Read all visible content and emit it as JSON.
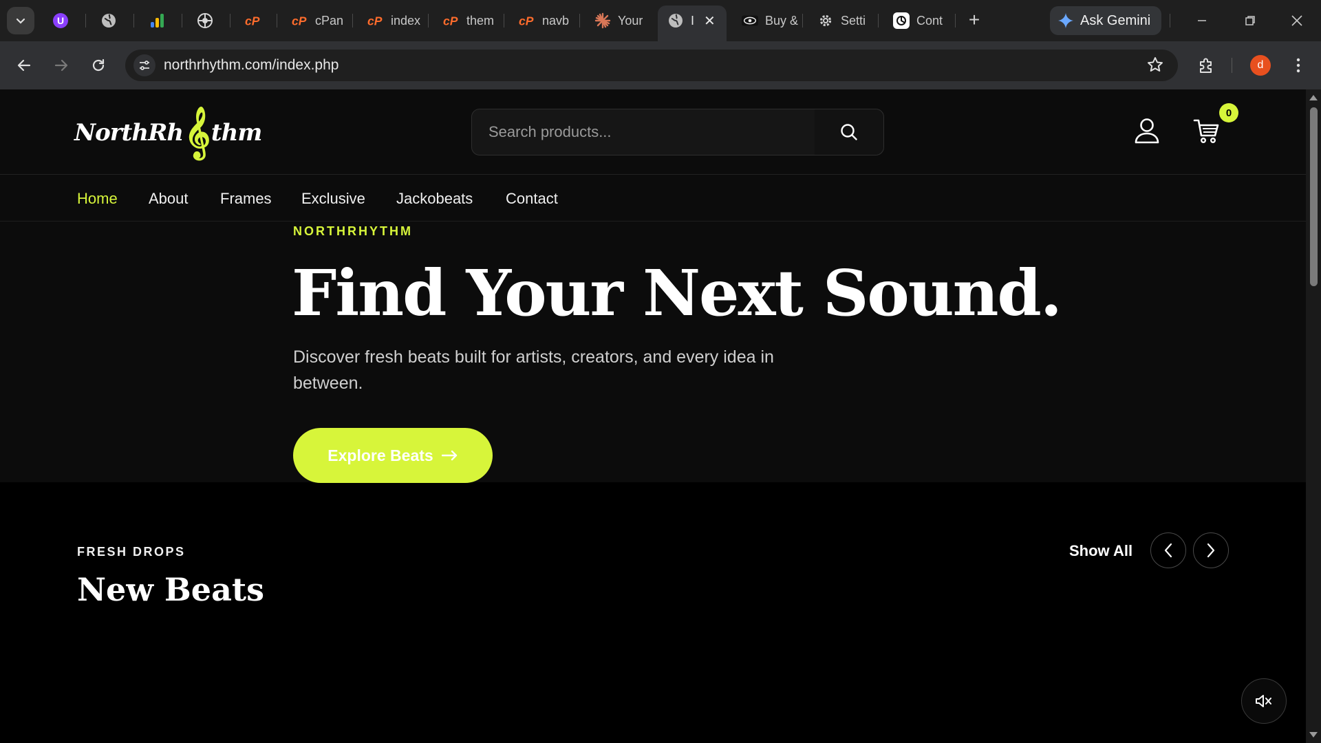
{
  "browser": {
    "tabs": [
      {
        "label": "",
        "icon": "u-extension-icon"
      },
      {
        "label": "",
        "icon": "globe-icon"
      },
      {
        "label": "",
        "icon": "analytics-icon"
      },
      {
        "label": "",
        "icon": "aperture-icon"
      },
      {
        "label": "",
        "icon": "cpanel-icon"
      },
      {
        "label": "cPan",
        "icon": "cpanel-icon"
      },
      {
        "label": "index",
        "icon": "cpanel-icon"
      },
      {
        "label": "them",
        "icon": "cpanel-icon"
      },
      {
        "label": "navb",
        "icon": "cpanel-icon"
      },
      {
        "label": "Your",
        "icon": "claude-icon"
      },
      {
        "label": "I",
        "icon": "globe-icon"
      },
      {
        "label": "Buy &",
        "icon": "eye-icon"
      },
      {
        "label": "Setti",
        "icon": "gear-icon"
      },
      {
        "label": "Cont",
        "icon": "openai-icon"
      }
    ],
    "active_tab_index": 10,
    "ask_gemini_label": "Ask Gemini",
    "url": "northrhythm.com/index.php",
    "profile_initial": "d",
    "accent_colors": {
      "profile": "#e8501f",
      "cpanel": "#ff6c2c"
    }
  },
  "site": {
    "logo": {
      "left": "NorthRh",
      "right": "thm",
      "clef": "𝄞"
    },
    "search_placeholder": "Search products...",
    "cart_count": "0",
    "nav": [
      "Home",
      "About",
      "Frames",
      "Exclusive",
      "Jackobeats",
      "Contact"
    ],
    "nav_active": "Home",
    "hero": {
      "eyebrow": "NORTHRHYTHM",
      "title": "Find Your Next Sound.",
      "subtitle": "Discover fresh beats built for artists, creators, and every idea in between.",
      "cta_label": "Explore Beats"
    },
    "section": {
      "eyebrow": "FRESH DROPS",
      "title": "New Beats",
      "show_all_label": "Show All"
    },
    "colors": {
      "accent": "#d7f53a",
      "background": "#000000",
      "header_bg": "#0c0c0c"
    }
  }
}
